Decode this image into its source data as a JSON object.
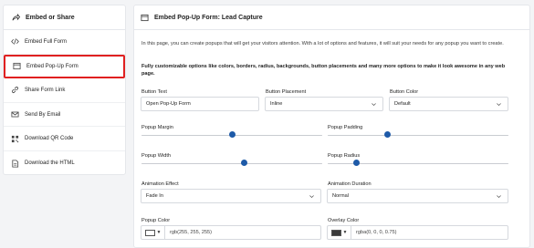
{
  "sidebar": {
    "title": "Embed or Share",
    "title_icon": "share-icon",
    "items": [
      {
        "label": "Embed Full Form",
        "icon": "code-icon"
      },
      {
        "label": "Embed Pop-Up Form",
        "icon": "popup-window-icon",
        "active": true
      },
      {
        "label": "Share Form Link",
        "icon": "link-icon"
      },
      {
        "label": "Send By Email",
        "icon": "envelope-icon"
      },
      {
        "label": "Download QR Code",
        "icon": "qr-code-icon"
      },
      {
        "label": "Download the HTML",
        "icon": "file-icon"
      }
    ]
  },
  "main": {
    "title": "Embed Pop-Up Form: Lead Capture",
    "title_icon": "popup-window-icon",
    "description": "In this page, you can create popups that will get your visitors attention. With a lot of options and features, it will suit your needs for any popup you want to create.",
    "highlight": "Fully customizable options like colors, borders, radius, backgrounds, button placements and many more options to make it look awesome in any web page.",
    "button_text": {
      "label": "Button Text",
      "value": "Open Pop-Up Form"
    },
    "button_placement": {
      "label": "Button Placement",
      "value": "Inline"
    },
    "button_color": {
      "label": "Button Color",
      "value": "Default"
    },
    "popup_margin": {
      "label": "Popup Margin",
      "level": 0.5
    },
    "popup_padding": {
      "label": "Popup Padding",
      "level": 0.33
    },
    "popup_width": {
      "label": "Popup Width",
      "level": 0.57
    },
    "popup_radius": {
      "label": "Popup Radius",
      "level": 0.16
    },
    "animation_effect": {
      "label": "Animation Effect",
      "value": "Fade In"
    },
    "animation_duration": {
      "label": "Animation Duration",
      "value": "Normal"
    },
    "popup_color": {
      "label": "Popup Color",
      "value": "rgb(255, 255, 255)",
      "swatch": "#ffffff"
    },
    "overlay_color": {
      "label": "Overlay Color",
      "value": "rgba(0, 0, 0, 0.75)",
      "swatch": "#3a3a3a"
    }
  },
  "colors": {
    "accent": "#1e5aa8",
    "active_border": "#e02020"
  }
}
